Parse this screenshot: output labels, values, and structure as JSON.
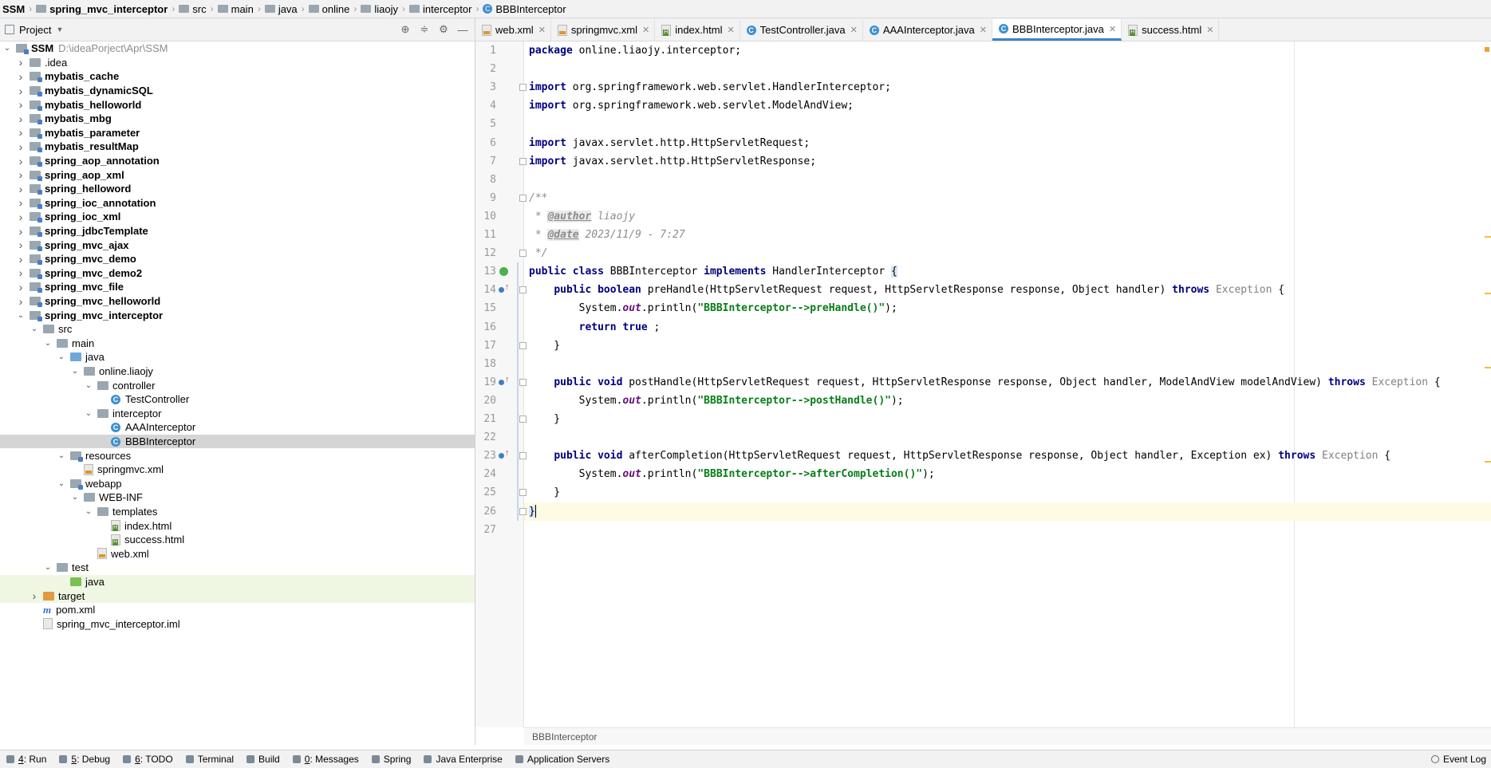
{
  "breadcrumb": [
    "SSM",
    "spring_mvc_interceptor",
    "src",
    "main",
    "java",
    "online",
    "liaojy",
    "interceptor",
    "BBBInterceptor"
  ],
  "project_pane": {
    "title": "Project",
    "tree": [
      {
        "label": "SSM",
        "extra": "D:\\ideaPorject\\Apr\\SSM",
        "depth": 0,
        "chev": "down",
        "icon": "folder-module",
        "bold": true
      },
      {
        "label": ".idea",
        "depth": 1,
        "chev": "right",
        "icon": "folder"
      },
      {
        "label": "mybatis_cache",
        "depth": 1,
        "chev": "right",
        "icon": "folder-module",
        "bold": true
      },
      {
        "label": "mybatis_dynamicSQL",
        "depth": 1,
        "chev": "right",
        "icon": "folder-module",
        "bold": true
      },
      {
        "label": "mybatis_helloworld",
        "depth": 1,
        "chev": "right",
        "icon": "folder-module",
        "bold": true
      },
      {
        "label": "mybatis_mbg",
        "depth": 1,
        "chev": "right",
        "icon": "folder-module",
        "bold": true
      },
      {
        "label": "mybatis_parameter",
        "depth": 1,
        "chev": "right",
        "icon": "folder-module",
        "bold": true
      },
      {
        "label": "mybatis_resultMap",
        "depth": 1,
        "chev": "right",
        "icon": "folder-module",
        "bold": true
      },
      {
        "label": "spring_aop_annotation",
        "depth": 1,
        "chev": "right",
        "icon": "folder-module",
        "bold": true
      },
      {
        "label": "spring_aop_xml",
        "depth": 1,
        "chev": "right",
        "icon": "folder-module",
        "bold": true
      },
      {
        "label": "spring_helloword",
        "depth": 1,
        "chev": "right",
        "icon": "folder-module",
        "bold": true
      },
      {
        "label": "spring_ioc_annotation",
        "depth": 1,
        "chev": "right",
        "icon": "folder-module",
        "bold": true
      },
      {
        "label": "spring_ioc_xml",
        "depth": 1,
        "chev": "right",
        "icon": "folder-module",
        "bold": true
      },
      {
        "label": "spring_jdbcTemplate",
        "depth": 1,
        "chev": "right",
        "icon": "folder-module",
        "bold": true
      },
      {
        "label": "spring_mvc_ajax",
        "depth": 1,
        "chev": "right",
        "icon": "folder-module",
        "bold": true
      },
      {
        "label": "spring_mvc_demo",
        "depth": 1,
        "chev": "right",
        "icon": "folder-module",
        "bold": true
      },
      {
        "label": "spring_mvc_demo2",
        "depth": 1,
        "chev": "right",
        "icon": "folder-module",
        "bold": true
      },
      {
        "label": "spring_mvc_file",
        "depth": 1,
        "chev": "right",
        "icon": "folder-module",
        "bold": true
      },
      {
        "label": "spring_mvc_helloworld",
        "depth": 1,
        "chev": "right",
        "icon": "folder-module",
        "bold": true
      },
      {
        "label": "spring_mvc_interceptor",
        "depth": 1,
        "chev": "down",
        "icon": "folder-module",
        "bold": true
      },
      {
        "label": "src",
        "depth": 2,
        "chev": "down",
        "icon": "folder"
      },
      {
        "label": "main",
        "depth": 3,
        "chev": "down",
        "icon": "folder"
      },
      {
        "label": "java",
        "depth": 4,
        "chev": "down",
        "icon": "folder-blue"
      },
      {
        "label": "online.liaojy",
        "depth": 5,
        "chev": "down",
        "icon": "folder"
      },
      {
        "label": "controller",
        "depth": 6,
        "chev": "down",
        "icon": "folder"
      },
      {
        "label": "TestController",
        "depth": 7,
        "chev": "none",
        "icon": "class"
      },
      {
        "label": "interceptor",
        "depth": 6,
        "chev": "down",
        "icon": "folder"
      },
      {
        "label": "AAAInterceptor",
        "depth": 7,
        "chev": "none",
        "icon": "class"
      },
      {
        "label": "BBBInterceptor",
        "depth": 7,
        "chev": "none",
        "icon": "class",
        "selected": true
      },
      {
        "label": "resources",
        "depth": 4,
        "chev": "down",
        "icon": "folder-res"
      },
      {
        "label": "springmvc.xml",
        "depth": 5,
        "chev": "none",
        "icon": "xml"
      },
      {
        "label": "webapp",
        "depth": 4,
        "chev": "down",
        "icon": "folder-web"
      },
      {
        "label": "WEB-INF",
        "depth": 5,
        "chev": "down",
        "icon": "folder"
      },
      {
        "label": "templates",
        "depth": 6,
        "chev": "down",
        "icon": "folder"
      },
      {
        "label": "index.html",
        "depth": 7,
        "chev": "none",
        "icon": "html"
      },
      {
        "label": "success.html",
        "depth": 7,
        "chev": "none",
        "icon": "html"
      },
      {
        "label": "web.xml",
        "depth": 6,
        "chev": "none",
        "icon": "xml"
      },
      {
        "label": "test",
        "depth": 3,
        "chev": "down",
        "icon": "folder"
      },
      {
        "label": "java",
        "depth": 4,
        "chev": "none",
        "icon": "folder-green",
        "green": true
      },
      {
        "label": "target",
        "depth": 2,
        "chev": "right",
        "icon": "folder-orange",
        "green": true
      },
      {
        "label": "pom.xml",
        "depth": 2,
        "chev": "none",
        "icon": "maven"
      },
      {
        "label": "spring_mvc_interceptor.iml",
        "depth": 2,
        "chev": "none",
        "icon": "iml"
      }
    ]
  },
  "editor_tabs": [
    {
      "label": "web.xml",
      "icon": "xml"
    },
    {
      "label": "springmvc.xml",
      "icon": "xml"
    },
    {
      "label": "index.html",
      "icon": "html"
    },
    {
      "label": "TestController.java",
      "icon": "class"
    },
    {
      "label": "AAAInterceptor.java",
      "icon": "class"
    },
    {
      "label": "BBBInterceptor.java",
      "icon": "class",
      "active": true
    },
    {
      "label": "success.html",
      "icon": "html"
    }
  ],
  "code_lines": [
    [
      [
        "kw",
        "package"
      ],
      [
        "",
        "online.liaojy.interceptor;"
      ]
    ],
    [],
    [
      [
        "kw",
        "import"
      ],
      [
        "",
        "org.springframework.web.servlet.HandlerInterceptor;"
      ]
    ],
    [
      [
        "kw",
        "import"
      ],
      [
        "",
        "org.springframework.web.servlet.ModelAndView;"
      ]
    ],
    [],
    [
      [
        "kw",
        "import"
      ],
      [
        "",
        "javax.servlet.http.HttpServletRequest;"
      ]
    ],
    [
      [
        "kw",
        "import"
      ],
      [
        "",
        "javax.servlet.http.HttpServletResponse;"
      ]
    ],
    [],
    [
      [
        "cmt",
        "/**"
      ]
    ],
    [
      [
        "cmt",
        " * "
      ],
      [
        "tag",
        "@author"
      ],
      [
        "cmt",
        " liaojy"
      ]
    ],
    [
      [
        "cmt",
        " * "
      ],
      [
        "tag",
        "@date"
      ],
      [
        "cmt",
        " 2023/11/9 - 7:27"
      ]
    ],
    [
      [
        "cmt",
        " */"
      ]
    ],
    [
      [
        "kw",
        "public class"
      ],
      [
        "",
        "BBBInterceptor "
      ],
      [
        "kw",
        "implements"
      ],
      [
        "",
        " HandlerInterceptor "
      ],
      [
        "brace",
        "{"
      ]
    ],
    [
      [
        "",
        "    "
      ],
      [
        "kw",
        "public boolean"
      ],
      [
        "",
        " preHandle(HttpServletRequest request, HttpServletResponse response, Object handler) "
      ],
      [
        "kw",
        "throws"
      ],
      [
        "exc",
        " Exception"
      ],
      [
        "",
        " {"
      ]
    ],
    [
      [
        "",
        "        System."
      ],
      [
        "out",
        "out"
      ],
      [
        "",
        ".println("
      ],
      [
        "str",
        "\"BBBInterceptor-->preHandle()\""
      ],
      [
        "",
        ");"
      ]
    ],
    [
      [
        "",
        "        "
      ],
      [
        "kw",
        "return true"
      ],
      [
        "",
        ";"
      ]
    ],
    [
      [
        "",
        "    }"
      ]
    ],
    [],
    [
      [
        "",
        "    "
      ],
      [
        "kw",
        "public void"
      ],
      [
        "",
        " postHandle(HttpServletRequest request, HttpServletResponse response, Object handler, ModelAndView modelAndView) "
      ],
      [
        "kw",
        "throws"
      ],
      [
        "exc",
        " Exception"
      ],
      [
        "",
        " {"
      ]
    ],
    [
      [
        "",
        "        System."
      ],
      [
        "out",
        "out"
      ],
      [
        "",
        ".println("
      ],
      [
        "str",
        "\"BBBInterceptor-->postHandle()\""
      ],
      [
        "",
        ");"
      ]
    ],
    [
      [
        "",
        "    }"
      ]
    ],
    [],
    [
      [
        "",
        "    "
      ],
      [
        "kw",
        "public void"
      ],
      [
        "",
        " afterCompletion(HttpServletRequest request, HttpServletResponse response, Object handler, Exception ex) "
      ],
      [
        "kw",
        "throws"
      ],
      [
        "exc",
        " Exception"
      ],
      [
        "",
        " {"
      ]
    ],
    [
      [
        "",
        "        System."
      ],
      [
        "out",
        "out"
      ],
      [
        "",
        ".println("
      ],
      [
        "str",
        "\"BBBInterceptor-->afterCompletion()\""
      ],
      [
        "",
        ");"
      ]
    ],
    [
      [
        "",
        "    }"
      ]
    ],
    [
      [
        "bracecaret",
        "}"
      ]
    ],
    []
  ],
  "editor_breadcrumb": "BBBInterceptor",
  "toolbar": {
    "items": [
      {
        "key": "4",
        "label": ": Run"
      },
      {
        "key": "5",
        "label": ": Debug"
      },
      {
        "key": "6",
        "label": ": TODO"
      },
      {
        "key": "",
        "label": "Terminal"
      },
      {
        "key": "",
        "label": "Build"
      },
      {
        "key": "0",
        "label": ": Messages"
      },
      {
        "key": "",
        "label": "Spring"
      },
      {
        "key": "",
        "label": "Java Enterprise"
      },
      {
        "key": "",
        "label": "Application Servers"
      }
    ],
    "event_log": "Event Log"
  }
}
